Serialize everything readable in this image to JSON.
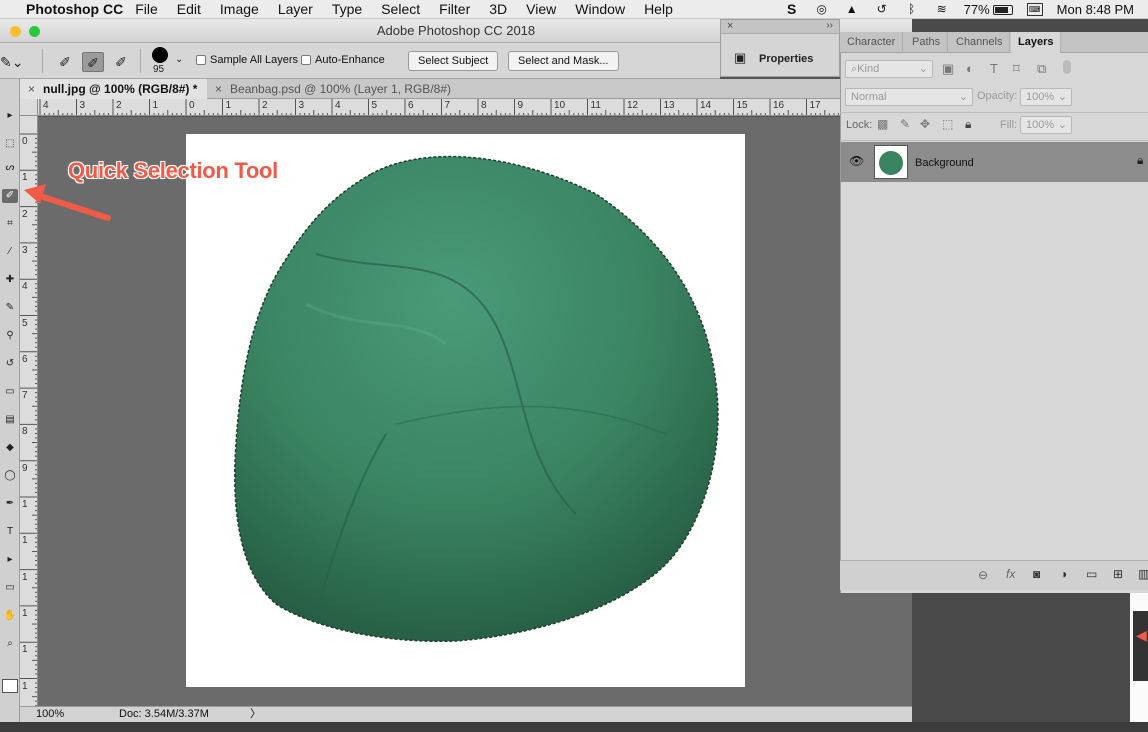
{
  "menubar": {
    "app_name": "Photoshop CC",
    "items": [
      "File",
      "Edit",
      "Image",
      "Layer",
      "Type",
      "Select",
      "Filter",
      "3D",
      "View",
      "Window",
      "Help"
    ],
    "battery": "77%",
    "clock": "Mon 8:48 PM"
  },
  "window": {
    "title": "Adobe Photoshop CC 2018"
  },
  "options_bar": {
    "brush_size": "95",
    "sample_all_layers": "Sample All Layers",
    "auto_enhance": "Auto-Enhance",
    "select_subject": "Select Subject",
    "select_and_mask": "Select and Mask..."
  },
  "tabs": [
    {
      "label": "null.jpg @ 100% (RGB/8#) *",
      "active": true
    },
    {
      "label": "Beanbag.psd @ 100% (Layer 1, RGB/8#)",
      "active": false
    }
  ],
  "ruler_h": [
    "4",
    "3",
    "2",
    "1",
    "0",
    "1",
    "2",
    "3",
    "4",
    "5",
    "6",
    "7",
    "8",
    "9",
    "10",
    "11",
    "12",
    "13",
    "14",
    "15",
    "16",
    "17",
    "1"
  ],
  "ruler_v": [
    "0",
    "1",
    "2",
    "3",
    "4",
    "5",
    "6",
    "7",
    "8",
    "9",
    "1",
    "1",
    "1",
    "1",
    "1",
    "1"
  ],
  "annotation": "Quick Selection Tool",
  "status": {
    "zoom": "100%",
    "doc": "Doc: 3.54M/3.37M",
    "arrow": "〉"
  },
  "properties": {
    "title": "Properties"
  },
  "layers_panel": {
    "tabs": [
      "Character",
      "Paths",
      "Channels",
      "Layers"
    ],
    "kind": "Kind",
    "blend_mode": "Normal",
    "opacity_label": "Opacity:",
    "opacity_value": "100%",
    "lock_label": "Lock:",
    "fill_label": "Fill:",
    "fill_value": "100%",
    "layer_name": "Background"
  },
  "colors": {
    "accent_annotation": "#f05a46",
    "beanbag": "#3f8a69",
    "canvas": "#ffffff",
    "pasteboard": "#6b6b6b"
  }
}
